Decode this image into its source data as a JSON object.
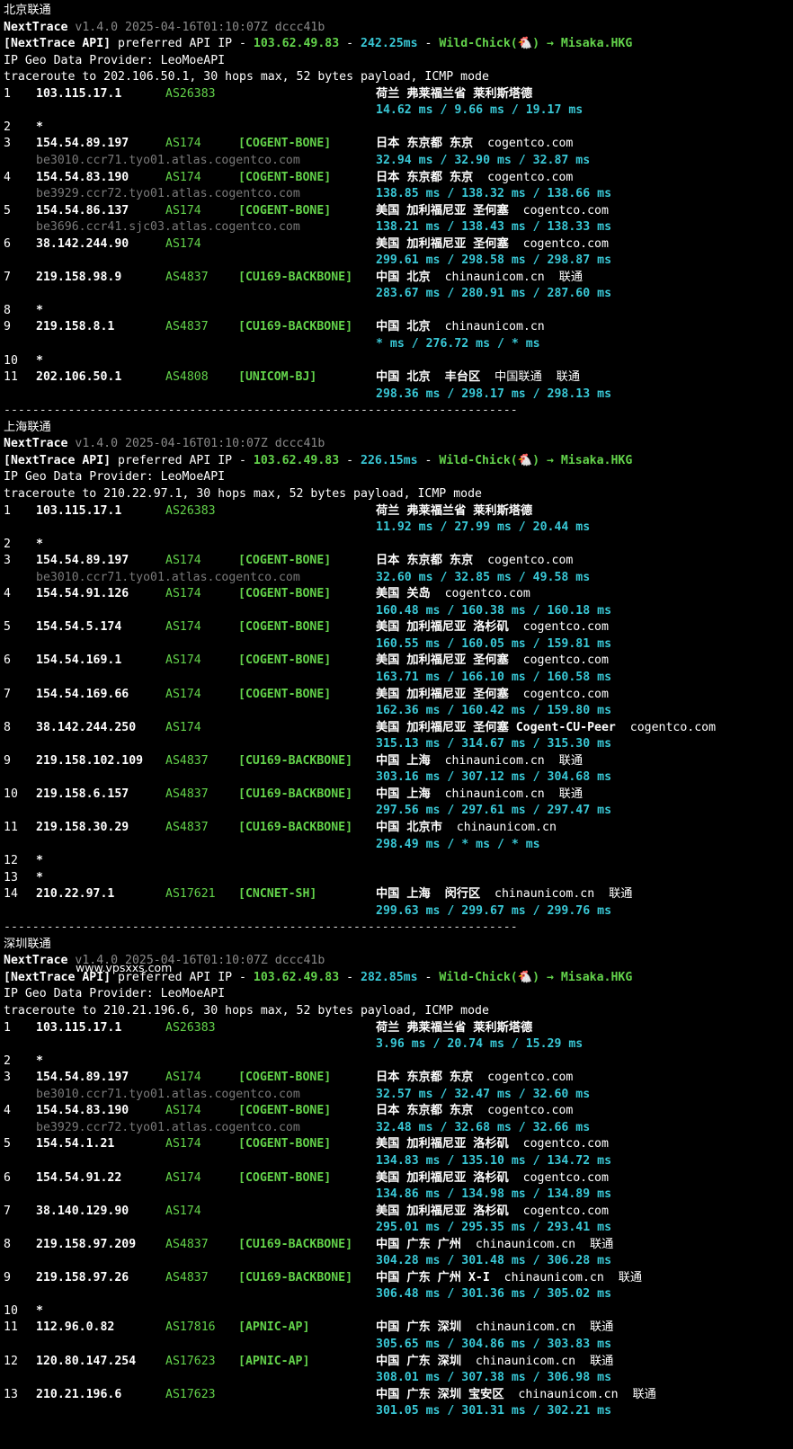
{
  "watermark": "www.vpsxxs.com",
  "sections": [
    {
      "title": "北京联通",
      "nexttrace_name": "NextTrace",
      "nexttrace_version": "v1.4.0 2025-04-16T01:10:07Z dccc41b",
      "api_tag": "[NextTrace API]",
      "api_text": "preferred API IP - ",
      "api_ip": "103.62.49.83",
      "api_dash": " - ",
      "api_latency": "242.25ms",
      "api_dash2": " - ",
      "api_node": "Wild-Chick(🐔) → Misaka.HKG",
      "geo_provider": "IP Geo Data Provider: LeoMoeAPI",
      "traceroute": "traceroute to 202.106.50.1, 30 hops max, 52 bytes payload, ICMP mode",
      "hops": [
        {
          "n": "1",
          "ip": "103.115.17.1",
          "as": "AS26383",
          "tag": "",
          "geo": "荷兰 弗莱福兰省 莱利斯塔德",
          "dom": "",
          "rtt": "14.62 ms / 9.66 ms / 19.17 ms"
        },
        {
          "n": "2",
          "star": "*"
        },
        {
          "n": "3",
          "ip": "154.54.89.197",
          "as": "AS174",
          "tag": "[COGENT-BONE]",
          "geo": "日本 东京都 东京",
          "dom": "cogentco.com",
          "host": "be3010.ccr71.tyo01.atlas.cogentco.com",
          "rtt": "32.94 ms / 32.90 ms / 32.87 ms"
        },
        {
          "n": "4",
          "ip": "154.54.83.190",
          "as": "AS174",
          "tag": "[COGENT-BONE]",
          "geo": "日本 东京都 东京",
          "dom": "cogentco.com",
          "host": "be3929.ccr72.tyo01.atlas.cogentco.com",
          "rtt": "138.85 ms / 138.32 ms / 138.66 ms"
        },
        {
          "n": "5",
          "ip": "154.54.86.137",
          "as": "AS174",
          "tag": "[COGENT-BONE]",
          "geo": "美国 加利福尼亚 圣何塞",
          "dom": "cogentco.com",
          "host": "be3696.ccr41.sjc03.atlas.cogentco.com",
          "rtt": "138.21 ms / 138.43 ms / 138.33 ms"
        },
        {
          "n": "6",
          "ip": "38.142.244.90",
          "as": "AS174",
          "tag": "",
          "geo": "美国 加利福尼亚 圣何塞",
          "dom": "cogentco.com",
          "rtt": "299.61 ms / 298.58 ms / 298.87 ms"
        },
        {
          "n": "7",
          "ip": "219.158.98.9",
          "as": "AS4837",
          "tag": "[CU169-BACKBONE]",
          "geo": "中国 北京",
          "dom": "chinaunicom.cn  联通",
          "rtt": "283.67 ms / 280.91 ms / 287.60 ms"
        },
        {
          "n": "8",
          "star": "*"
        },
        {
          "n": "9",
          "ip": "219.158.8.1",
          "as": "AS4837",
          "tag": "[CU169-BACKBONE]",
          "geo": "中国 北京",
          "dom": "chinaunicom.cn",
          "rtt": "* ms / 276.72 ms / * ms"
        },
        {
          "n": "10",
          "star": "*"
        },
        {
          "n": "11",
          "ip": "202.106.50.1",
          "as": "AS4808",
          "tag": "[UNICOM-BJ]",
          "geo": "中国 北京  丰台区",
          "dom": "中国联通  联通",
          "rtt": "298.36 ms / 298.17 ms / 298.13 ms"
        }
      ],
      "separator": "------------------------------------------------------------------------"
    },
    {
      "title": "上海联通",
      "nexttrace_name": "NextTrace",
      "nexttrace_version": "v1.4.0 2025-04-16T01:10:07Z dccc41b",
      "api_tag": "[NextTrace API]",
      "api_text": "preferred API IP - ",
      "api_ip": "103.62.49.83",
      "api_dash": " - ",
      "api_latency": "226.15ms",
      "api_dash2": " - ",
      "api_node": "Wild-Chick(🐔) → Misaka.HKG",
      "geo_provider": "IP Geo Data Provider: LeoMoeAPI",
      "traceroute": "traceroute to 210.22.97.1, 30 hops max, 52 bytes payload, ICMP mode",
      "hops": [
        {
          "n": "1",
          "ip": "103.115.17.1",
          "as": "AS26383",
          "tag": "",
          "geo": "荷兰 弗莱福兰省 莱利斯塔德",
          "dom": "",
          "rtt": "11.92 ms / 27.99 ms / 20.44 ms"
        },
        {
          "n": "2",
          "star": "*"
        },
        {
          "n": "3",
          "ip": "154.54.89.197",
          "as": "AS174",
          "tag": "[COGENT-BONE]",
          "geo": "日本 东京都 东京",
          "dom": "cogentco.com",
          "host": "be3010.ccr71.tyo01.atlas.cogentco.com",
          "rtt": "32.60 ms / 32.85 ms / 49.58 ms"
        },
        {
          "n": "4",
          "ip": "154.54.91.126",
          "as": "AS174",
          "tag": "[COGENT-BONE]",
          "geo": "美国 关岛",
          "dom": "cogentco.com",
          "rtt": "160.48 ms / 160.38 ms / 160.18 ms"
        },
        {
          "n": "5",
          "ip": "154.54.5.174",
          "as": "AS174",
          "tag": "[COGENT-BONE]",
          "geo": "美国 加利福尼亚 洛杉矶",
          "dom": "cogentco.com",
          "rtt": "160.55 ms / 160.05 ms / 159.81 ms"
        },
        {
          "n": "6",
          "ip": "154.54.169.1",
          "as": "AS174",
          "tag": "[COGENT-BONE]",
          "geo": "美国 加利福尼亚 圣何塞",
          "dom": "cogentco.com",
          "rtt": "163.71 ms / 166.10 ms / 160.58 ms"
        },
        {
          "n": "7",
          "ip": "154.54.169.66",
          "as": "AS174",
          "tag": "[COGENT-BONE]",
          "geo": "美国 加利福尼亚 圣何塞",
          "dom": "cogentco.com",
          "rtt": "162.36 ms / 160.42 ms / 159.80 ms"
        },
        {
          "n": "8",
          "ip": "38.142.244.250",
          "as": "AS174",
          "tag": "",
          "geo": "美国 加利福尼亚 圣何塞 Cogent-CU-Peer",
          "dom": "cogentco.com",
          "rtt": "315.13 ms / 314.67 ms / 315.30 ms"
        },
        {
          "n": "9",
          "ip": "219.158.102.109",
          "as": "AS4837",
          "tag": "[CU169-BACKBONE]",
          "geo": "中国 上海",
          "dom": "chinaunicom.cn  联通",
          "rtt": "303.16 ms / 307.12 ms / 304.68 ms"
        },
        {
          "n": "10",
          "ip": "219.158.6.157",
          "as": "AS4837",
          "tag": "[CU169-BACKBONE]",
          "geo": "中国 上海",
          "dom": "chinaunicom.cn  联通",
          "rtt": "297.56 ms / 297.61 ms / 297.47 ms"
        },
        {
          "n": "11",
          "ip": "219.158.30.29",
          "as": "AS4837",
          "tag": "[CU169-BACKBONE]",
          "geo": "中国 北京市",
          "dom": "chinaunicom.cn",
          "rtt": "298.49 ms / * ms / * ms"
        },
        {
          "n": "12",
          "star": "*"
        },
        {
          "n": "13",
          "star": "*"
        },
        {
          "n": "14",
          "ip": "210.22.97.1",
          "as": "AS17621",
          "tag": "[CNCNET-SH]",
          "geo": "中国 上海  闵行区",
          "dom": "chinaunicom.cn  联通",
          "rtt": "299.63 ms / 299.67 ms / 299.76 ms"
        }
      ],
      "separator": "------------------------------------------------------------------------"
    },
    {
      "title": "深圳联通",
      "nexttrace_name": "NextTrace",
      "nexttrace_version": "v1.4.0 2025-04-16T01:10:07Z dccc41b",
      "api_tag": "[NextTrace API]",
      "api_text": "preferred API IP - ",
      "api_ip": "103.62.49.83",
      "api_dash": " - ",
      "api_latency": "282.85ms",
      "api_dash2": " - ",
      "api_node": "Wild-Chick(🐔) → Misaka.HKG",
      "geo_provider": "IP Geo Data Provider: LeoMoeAPI",
      "traceroute": "traceroute to 210.21.196.6, 30 hops max, 52 bytes payload, ICMP mode",
      "hops": [
        {
          "n": "1",
          "ip": "103.115.17.1",
          "as": "AS26383",
          "tag": "",
          "geo": "荷兰 弗莱福兰省 莱利斯塔德",
          "dom": "",
          "rtt": "3.96 ms / 20.74 ms / 15.29 ms"
        },
        {
          "n": "2",
          "star": "*"
        },
        {
          "n": "3",
          "ip": "154.54.89.197",
          "as": "AS174",
          "tag": "[COGENT-BONE]",
          "geo": "日本 东京都 东京",
          "dom": "cogentco.com",
          "host": "be3010.ccr71.tyo01.atlas.cogentco.com",
          "rtt": "32.57 ms / 32.47 ms / 32.60 ms"
        },
        {
          "n": "4",
          "ip": "154.54.83.190",
          "as": "AS174",
          "tag": "[COGENT-BONE]",
          "geo": "日本 东京都 东京",
          "dom": "cogentco.com",
          "host": "be3929.ccr72.tyo01.atlas.cogentco.com",
          "rtt": "32.48 ms / 32.68 ms / 32.66 ms"
        },
        {
          "n": "5",
          "ip": "154.54.1.21",
          "as": "AS174",
          "tag": "[COGENT-BONE]",
          "geo": "美国 加利福尼亚 洛杉矶",
          "dom": "cogentco.com",
          "rtt": "134.83 ms / 135.10 ms / 134.72 ms"
        },
        {
          "n": "6",
          "ip": "154.54.91.22",
          "as": "AS174",
          "tag": "[COGENT-BONE]",
          "geo": "美国 加利福尼亚 洛杉矶",
          "dom": "cogentco.com",
          "rtt": "134.86 ms / 134.98 ms / 134.89 ms"
        },
        {
          "n": "7",
          "ip": "38.140.129.90",
          "as": "AS174",
          "tag": "",
          "geo": "美国 加利福尼亚 洛杉矶",
          "dom": "cogentco.com",
          "rtt": "295.01 ms / 295.35 ms / 293.41 ms"
        },
        {
          "n": "8",
          "ip": "219.158.97.209",
          "as": "AS4837",
          "tag": "[CU169-BACKBONE]",
          "geo": "中国 广东 广州",
          "dom": "chinaunicom.cn  联通",
          "rtt": "304.28 ms / 301.48 ms / 306.28 ms"
        },
        {
          "n": "9",
          "ip": "219.158.97.26",
          "as": "AS4837",
          "tag": "[CU169-BACKBONE]",
          "geo": "中国 广东 广州 X-I",
          "dom": "chinaunicom.cn  联通",
          "rtt": "306.48 ms / 301.36 ms / 305.02 ms"
        },
        {
          "n": "10",
          "star": "*"
        },
        {
          "n": "11",
          "ip": "112.96.0.82",
          "as": "AS17816",
          "tag": "[APNIC-AP]",
          "geo": "中国 广东 深圳",
          "dom": "chinaunicom.cn  联通",
          "rtt": "305.65 ms / 304.86 ms / 303.83 ms"
        },
        {
          "n": "12",
          "ip": "120.80.147.254",
          "as": "AS17623",
          "tag": "[APNIC-AP]",
          "geo": "中国 广东 深圳",
          "dom": "chinaunicom.cn  联通",
          "rtt": "308.01 ms / 307.38 ms / 306.98 ms"
        },
        {
          "n": "13",
          "ip": "210.21.196.6",
          "as": "AS17623",
          "tag": "",
          "geo": "中国 广东 深圳 宝安区",
          "dom": "chinaunicom.cn  联通",
          "rtt": "301.05 ms / 301.31 ms / 302.21 ms"
        }
      ]
    }
  ]
}
